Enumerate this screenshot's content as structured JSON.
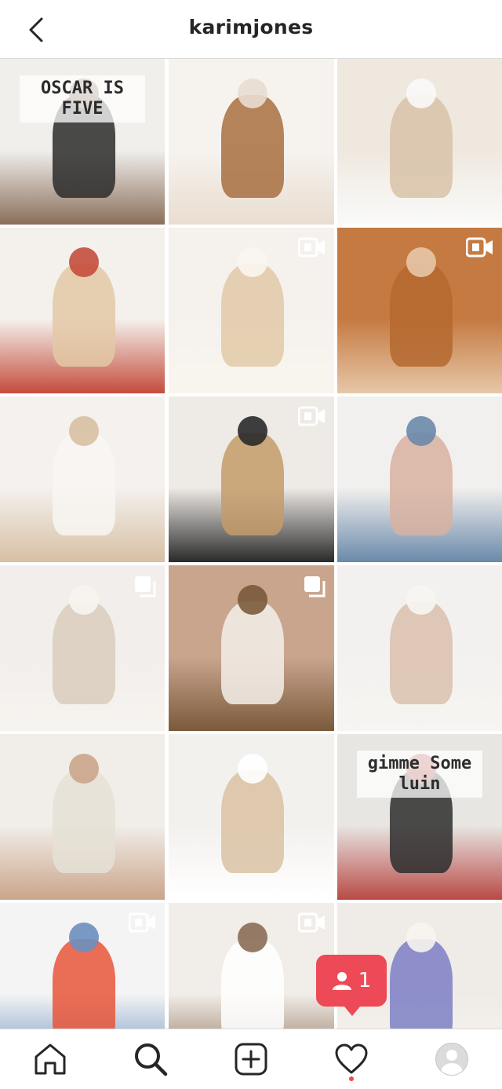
{
  "header": {
    "username": "karimjones",
    "back_icon": "chevron-left-icon"
  },
  "grid": {
    "posts": [
      {
        "id": "post-1",
        "type": "photo",
        "palette": [
          "#f1efec",
          "#2b2b2b",
          "#8a6f5a"
        ],
        "lettering": "OSCAR IS FIVE"
      },
      {
        "id": "post-2",
        "type": "photo",
        "palette": [
          "#f6f3ef",
          "#a86f3f",
          "#e9ddd0"
        ]
      },
      {
        "id": "post-3",
        "type": "photo",
        "palette": [
          "#efe8df",
          "#d8c2a8",
          "#fafafa"
        ]
      },
      {
        "id": "post-4",
        "type": "photo",
        "palette": [
          "#f4f1ed",
          "#e3c9a6",
          "#c44c3c"
        ]
      },
      {
        "id": "post-5",
        "type": "video",
        "palette": [
          "#f5f2ee",
          "#e2c9a7",
          "#f9f5ee"
        ]
      },
      {
        "id": "post-6",
        "type": "video",
        "palette": [
          "#c57a41",
          "#b4692f",
          "#e6c7a8"
        ]
      },
      {
        "id": "post-7",
        "type": "photo",
        "palette": [
          "#f4f1ee",
          "#f8f6f2",
          "#d7c0a3"
        ]
      },
      {
        "id": "post-8",
        "type": "video",
        "palette": [
          "#eeeae5",
          "#c49b6a",
          "#2a2a2a"
        ]
      },
      {
        "id": "post-9",
        "type": "photo",
        "palette": [
          "#f2f0ee",
          "#d8b2a0",
          "#6a89aa"
        ]
      },
      {
        "id": "post-10",
        "type": "carousel",
        "palette": [
          "#f1eeeb",
          "#d9cdbd",
          "#f7f4f0"
        ]
      },
      {
        "id": "post-11",
        "type": "carousel",
        "palette": [
          "#c9a58e",
          "#f3efe9",
          "#7a5a3b"
        ]
      },
      {
        "id": "post-12",
        "type": "photo",
        "palette": [
          "#f3f1ef",
          "#d9c0ad",
          "#f7f5f2"
        ]
      },
      {
        "id": "post-13",
        "type": "photo",
        "palette": [
          "#f1eee9",
          "#e5e0d6",
          "#caa58b"
        ]
      },
      {
        "id": "post-14",
        "type": "photo",
        "palette": [
          "#f3f1ee",
          "#d9c2a3",
          "#ffffff"
        ]
      },
      {
        "id": "post-15",
        "type": "photo",
        "palette": [
          "#e8e6e3",
          "#2d2d2d",
          "#b84a45"
        ],
        "lettering": "gimme Some luin"
      },
      {
        "id": "post-16",
        "type": "video",
        "palette": [
          "#f4f4f4",
          "#e8553a",
          "#6b8fbf"
        ]
      },
      {
        "id": "post-17",
        "type": "video",
        "palette": [
          "#f1ede8",
          "#ffffff",
          "#8a6d55"
        ]
      },
      {
        "id": "post-18",
        "type": "photo",
        "palette": [
          "#efebe6",
          "#7d7fc4",
          "#f7f4ef"
        ]
      },
      {
        "id": "post-19",
        "type": "photo",
        "palette": [
          "#e7d6c8",
          "#f1ece6"
        ]
      },
      {
        "id": "post-20",
        "type": "photo",
        "palette": [
          "#efeae5",
          "#f7f4ef"
        ]
      },
      {
        "id": "post-21",
        "type": "photo",
        "palette": [
          "#f0ede8",
          "#e0d5c8"
        ]
      }
    ]
  },
  "notification": {
    "count": "1",
    "icon": "person-icon",
    "color": "#ed4956"
  },
  "bottom_nav": {
    "items": [
      {
        "name": "home",
        "icon": "home-icon"
      },
      {
        "name": "search",
        "icon": "search-icon",
        "active": true
      },
      {
        "name": "new-post",
        "icon": "add-square-icon"
      },
      {
        "name": "activity",
        "icon": "heart-icon",
        "has_dot": true
      },
      {
        "name": "profile",
        "icon": "avatar-icon"
      }
    ]
  }
}
